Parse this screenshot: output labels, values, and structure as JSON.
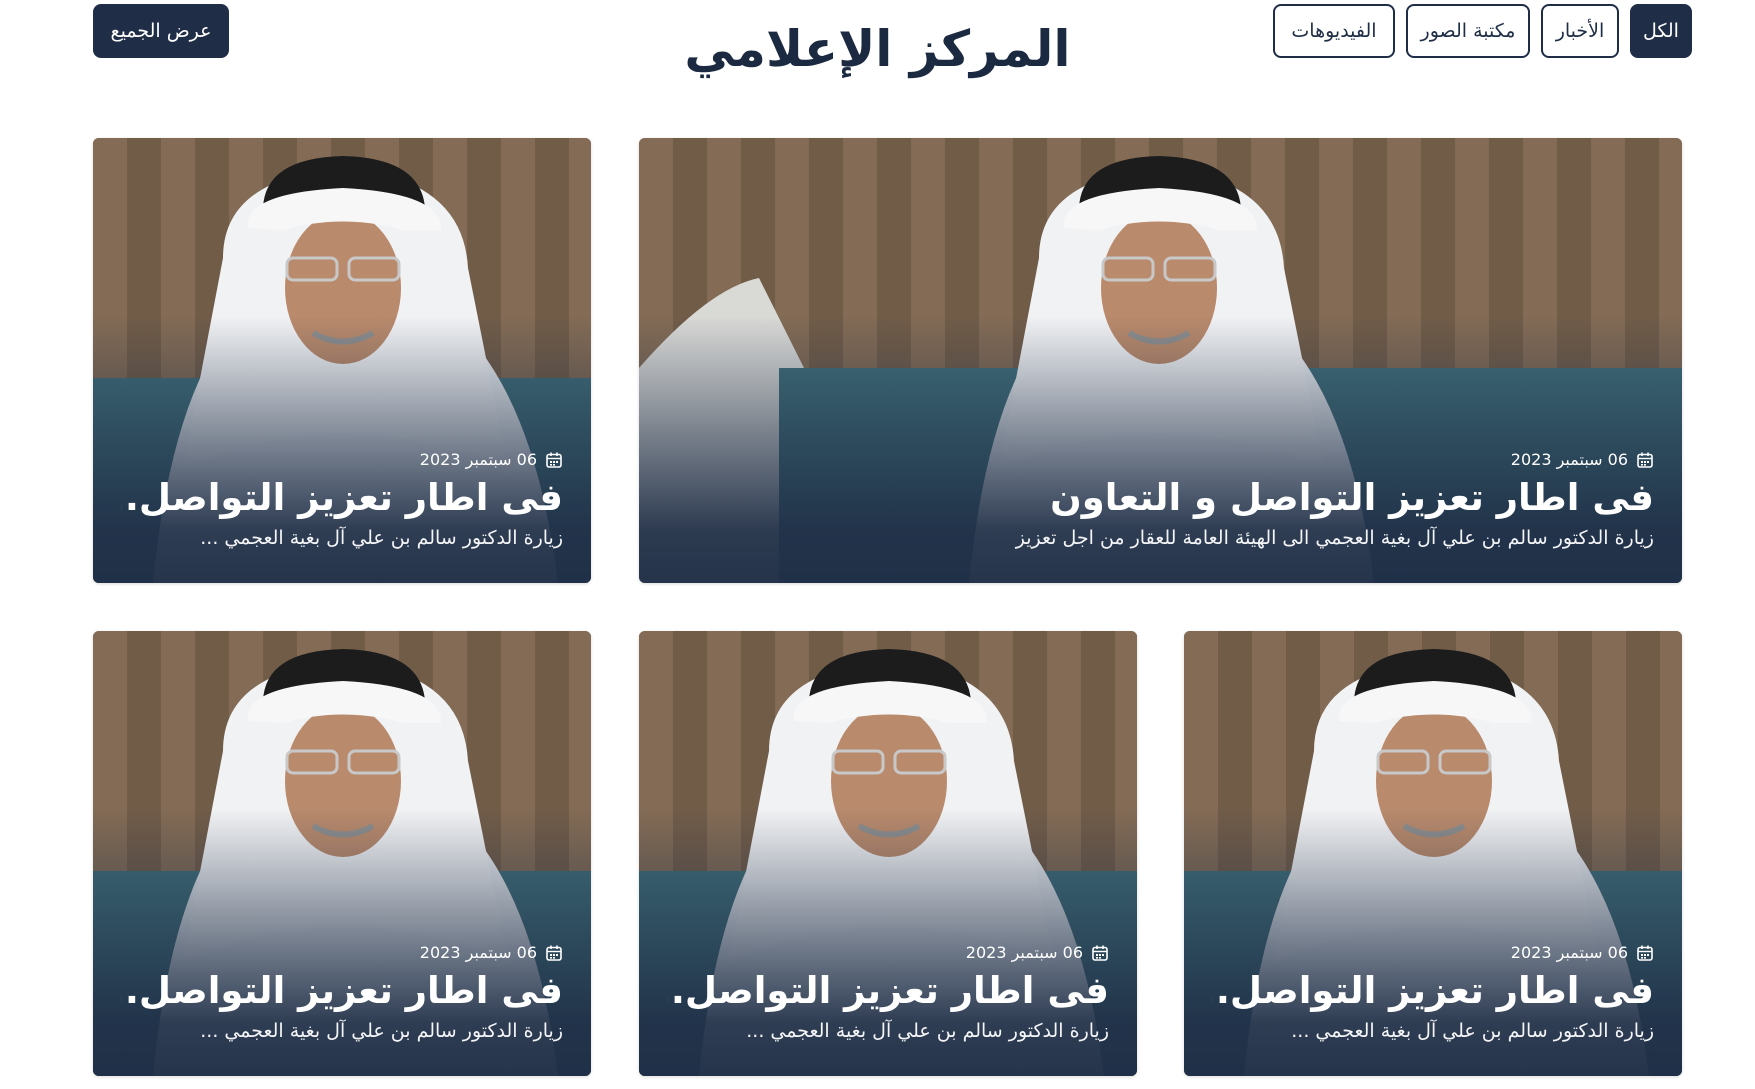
{
  "header": {
    "title": "المركز الإعلامي",
    "view_all_label": "عرض الجميع",
    "tabs": [
      {
        "label": "الكل",
        "active": true
      },
      {
        "label": "الأخبار",
        "active": false
      },
      {
        "label": "مكتبة الصور",
        "active": false
      },
      {
        "label": "الفيديوهات",
        "active": false
      }
    ]
  },
  "colors": {
    "primary": "#1f2e46",
    "background": "#ffffff",
    "overlay": "#1f2e46"
  },
  "icons": {
    "date": "calendar-icon"
  },
  "cards": [
    {
      "date": "06 سبتمبر 2023",
      "title": "فى اطار تعزيز التواصل و التعاون",
      "description": "زيارة الدكتور سالم بن علي آل بغية العجمي الى الهيئة العامة للعقار من اجل تعزيز"
    },
    {
      "date": "06 سبتمبر 2023",
      "title": "فى اطار تعزيز التواصل...",
      "description": "زيارة الدكتور سالم بن علي آل بغية العجمي ..."
    },
    {
      "date": "06 سبتمبر 2023",
      "title": "فى اطار تعزيز التواصل...",
      "description": "زيارة الدكتور سالم بن علي آل بغية العجمي ..."
    },
    {
      "date": "06 سبتمبر 2023",
      "title": "فى اطار تعزيز التواصل...",
      "description": "زيارة الدكتور سالم بن علي آل بغية العجمي ..."
    },
    {
      "date": "06 سبتمبر 2023",
      "title": "فى اطار تعزيز التواصل...",
      "description": "زيارة الدكتور سالم بن علي آل بغية العجمي ..."
    }
  ]
}
